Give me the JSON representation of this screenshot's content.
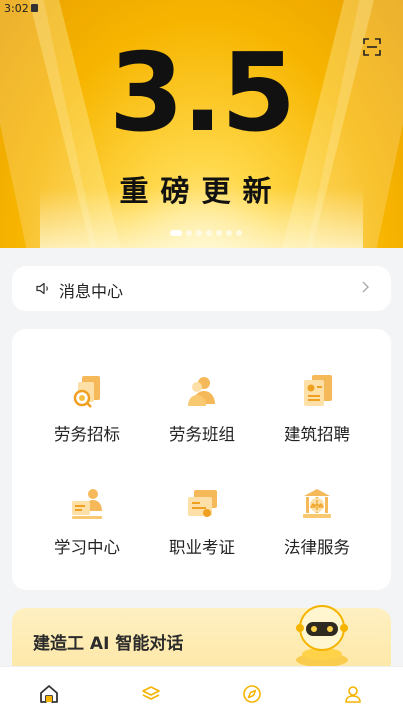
{
  "status_bar": {
    "time": "3:02"
  },
  "banner": {
    "headline": "3.5",
    "subhead": "重磅更新",
    "page_count": 7,
    "active_page": 1
  },
  "message_center": {
    "label": "消息中心"
  },
  "services": [
    {
      "label": "劳务招标",
      "icon": "bid-search-icon"
    },
    {
      "label": "劳务班组",
      "icon": "team-icon"
    },
    {
      "label": "建筑招聘",
      "icon": "resume-icon"
    },
    {
      "label": "学习中心",
      "icon": "learning-icon"
    },
    {
      "label": "职业考证",
      "icon": "certificate-icon"
    },
    {
      "label": "法律服务",
      "icon": "law-scale-icon"
    }
  ],
  "ai_card": {
    "label": "建造工 AI 智能对话",
    "icon": "robot-icon"
  },
  "tab_bar": {
    "tabs": [
      {
        "icon": "home-icon",
        "active": true
      },
      {
        "icon": "layers-icon",
        "active": false
      },
      {
        "icon": "compass-icon",
        "active": false
      },
      {
        "icon": "profile-icon",
        "active": false
      }
    ],
    "accent": "#f5b400"
  },
  "colors": {
    "accent": "#f5b400",
    "background": "#f3f4f6"
  }
}
